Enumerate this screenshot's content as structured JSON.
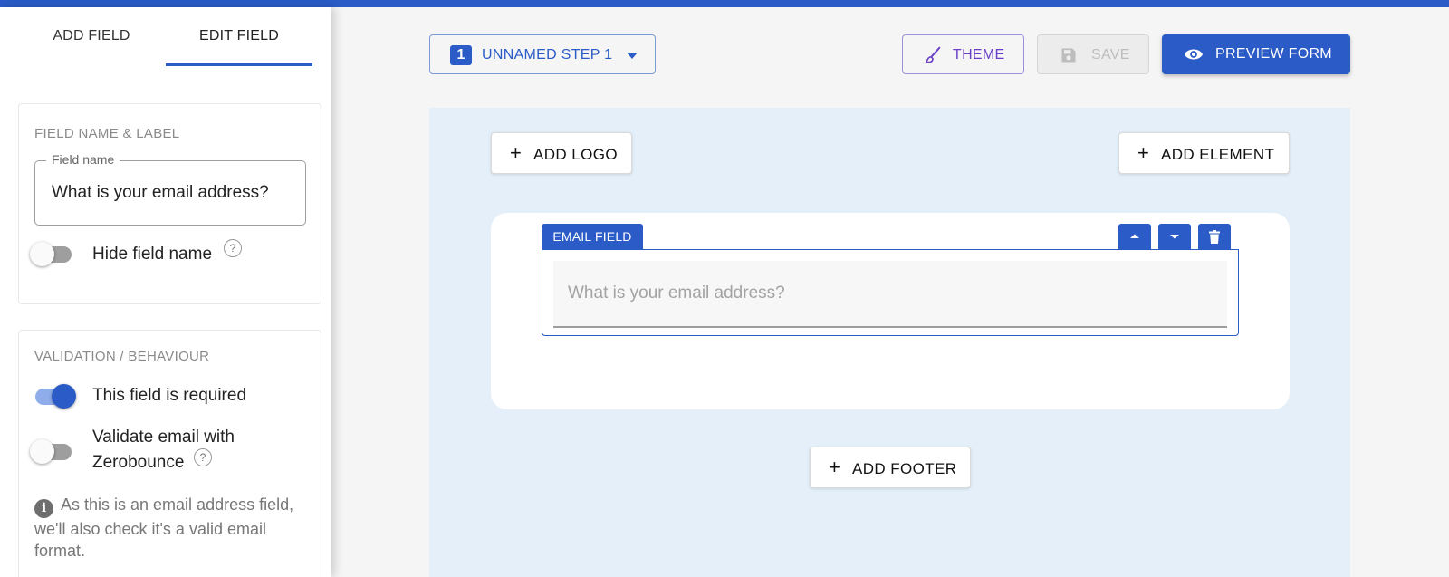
{
  "sidebar": {
    "tabs": [
      {
        "label": "ADD FIELD",
        "active": false
      },
      {
        "label": "EDIT FIELD",
        "active": true
      }
    ],
    "field_name_card": {
      "title": "FIELD NAME & LABEL",
      "field_name_legend": "Field name",
      "field_name_value": "What is your email address?",
      "hide_field_name_label": "Hide field name",
      "hide_field_name_on": false,
      "help_glyph": "?"
    },
    "validation_card": {
      "title": "VALIDATION / BEHAVIOUR",
      "required_label": "This field is required",
      "required_on": true,
      "zerobounce_label_line1": "Validate email with",
      "zerobounce_label_line2": "Zerobounce",
      "zerobounce_on": false,
      "help_glyph": "?",
      "info_glyph": "i",
      "info_text": "As this is an email address field, we'll also check it's a valid email format."
    }
  },
  "toolbar": {
    "step_number": "1",
    "step_label": "UNNAMED STEP 1",
    "theme_label": "THEME",
    "save_label": "SAVE",
    "save_disabled": true,
    "preview_label": "PREVIEW FORM"
  },
  "canvas": {
    "add_logo_label": "ADD LOGO",
    "add_element_label": "ADD ELEMENT",
    "add_footer_label": "ADD FOOTER",
    "plus_glyph": "+",
    "email_field": {
      "tag_label": "EMAIL FIELD",
      "placeholder": "What is your email address?"
    }
  },
  "colors": {
    "accent": "#2a5bc7",
    "theme_purple": "#6a3fc7",
    "canvas_bg": "#e4eff9"
  }
}
